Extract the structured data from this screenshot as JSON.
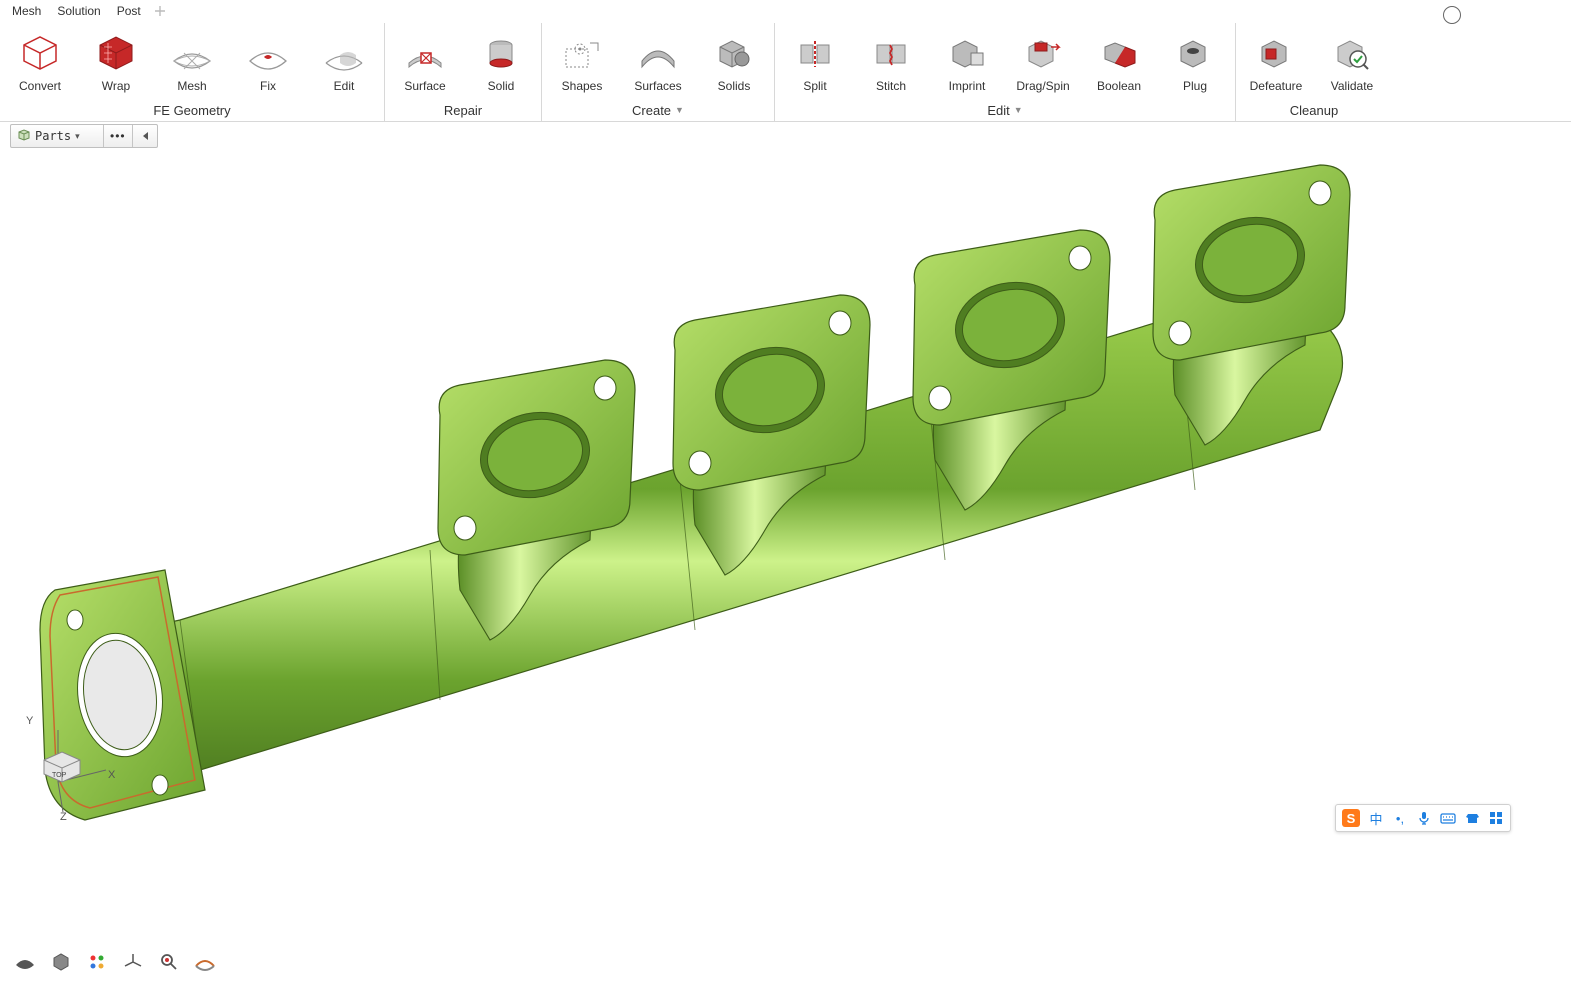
{
  "menu": {
    "items": [
      "Mesh",
      "Solution",
      "Post"
    ]
  },
  "ribbon": {
    "groups": [
      {
        "label": "FE Geometry",
        "dropdown": false,
        "buttons": [
          "Convert",
          "Wrap",
          "Mesh",
          "Fix",
          "Edit"
        ]
      },
      {
        "label": "Repair",
        "dropdown": false,
        "buttons": [
          "Surface",
          "Solid"
        ]
      },
      {
        "label": "Create",
        "dropdown": true,
        "buttons": [
          "Shapes",
          "Surfaces",
          "Solids"
        ]
      },
      {
        "label": "Edit",
        "dropdown": true,
        "buttons": [
          "Split",
          "Stitch",
          "Imprint",
          "Drag/Spin",
          "Boolean",
          "Plug"
        ]
      },
      {
        "label": "Cleanup",
        "dropdown": false,
        "buttons": [
          "Defeature",
          "Validate"
        ]
      }
    ]
  },
  "subbar": {
    "parts_label": "Parts"
  },
  "triad": {
    "axes": [
      "X",
      "Y",
      "Z"
    ],
    "cube_face": "TOP"
  },
  "ime": {
    "logo": "S",
    "items": [
      "中",
      "•,",
      "🎤",
      "⌨",
      "👕",
      "⊞"
    ]
  }
}
